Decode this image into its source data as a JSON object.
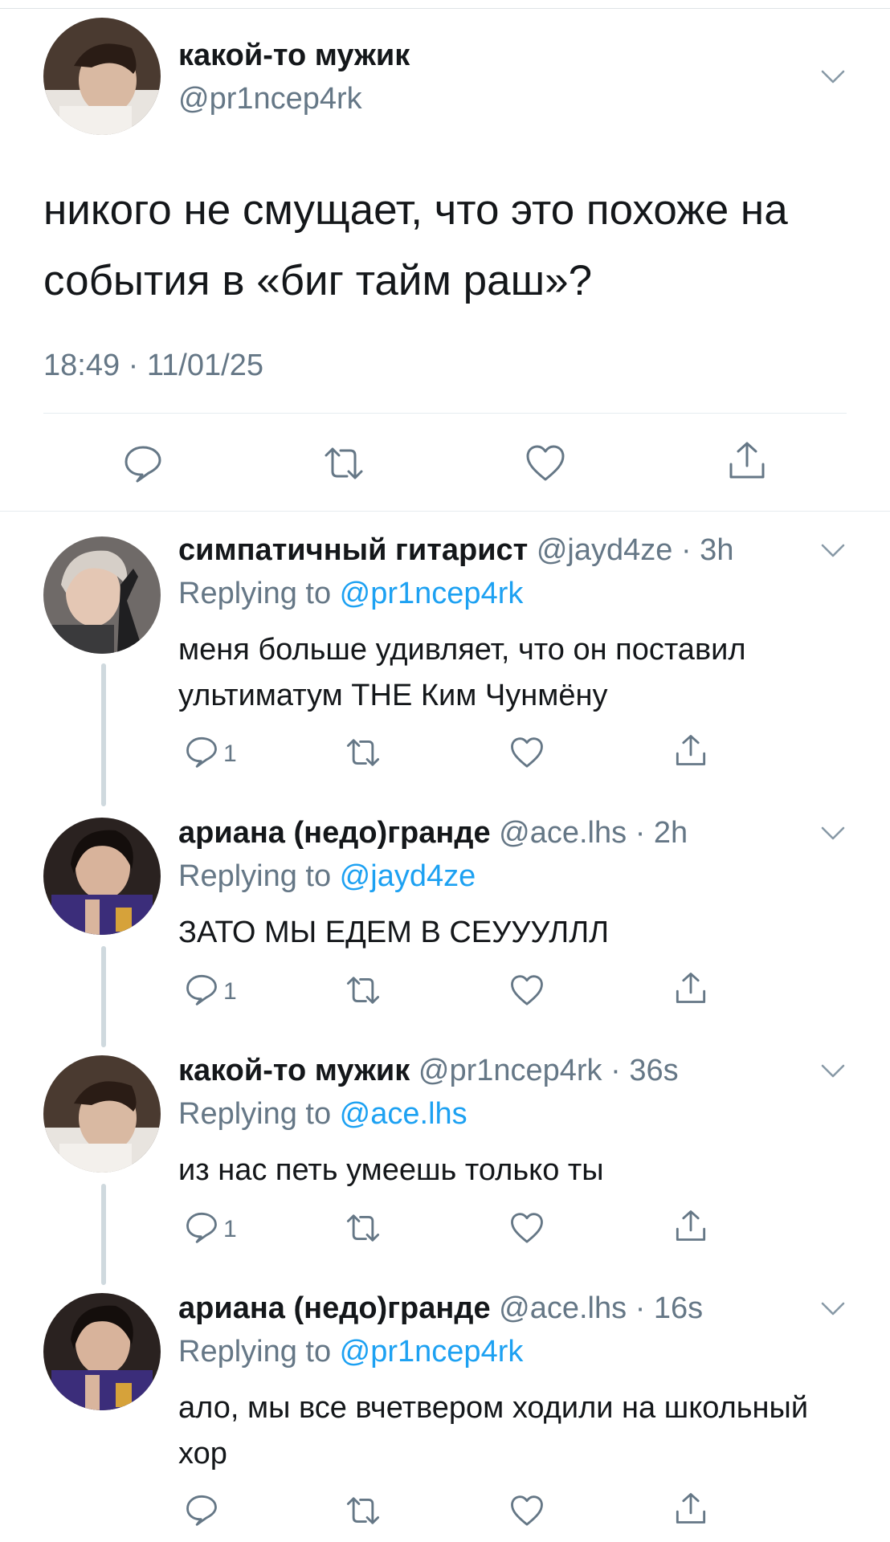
{
  "colors": {
    "text": "#14171a",
    "secondary": "#657786",
    "link": "#1da1f2",
    "divider": "#e6ecf0",
    "thread_line": "#cfd9de"
  },
  "main_tweet": {
    "name": "какой-то мужик",
    "handle": "@pr1ncep4rk",
    "text": "никого не смущает, что это похоже на события в «биг тайм раш»?",
    "timestamp": "18:49 · 11/01/25",
    "actions": [
      "reply-icon",
      "retweet-icon",
      "like-icon",
      "share-icon"
    ]
  },
  "replying_prefix": "Replying to ",
  "replies": [
    {
      "name": "симпатичный гитарист",
      "meta": "@jayd4ze · 3h",
      "replying_to": "@pr1ncep4rk",
      "text": "меня больше удивляет, что он поставил ультиматум ТНЕ Ким Чунмёну",
      "reply_count": "1"
    },
    {
      "name": "ариана (недо)гранде",
      "meta": "@ace.lhs · 2h",
      "replying_to": "@jayd4ze",
      "text": "ЗАТО МЫ ЕДЕМ В СЕУУУЛЛЛ",
      "reply_count": "1"
    },
    {
      "name": "какой-то мужик",
      "meta": "@pr1ncep4rk · 36s",
      "replying_to": "@ace.lhs",
      "text": "из нас петь умеешь только ты",
      "reply_count": "1"
    },
    {
      "name": "ариана (недо)гранде",
      "meta": "@ace.lhs · 16s",
      "replying_to": "@pr1ncep4rk",
      "text": "ало, мы все вчетвером ходили на школьный хор",
      "reply_count": ""
    }
  ]
}
